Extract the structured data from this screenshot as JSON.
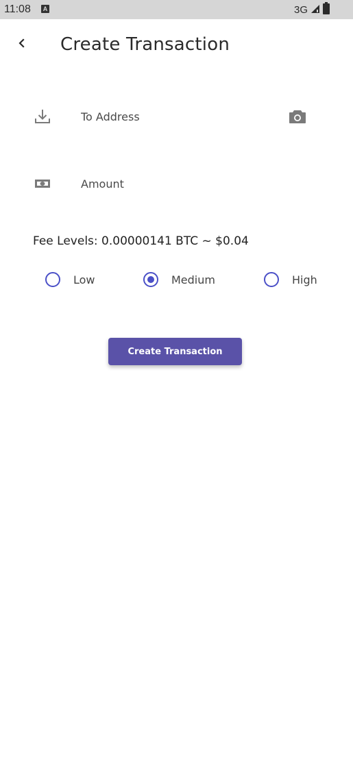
{
  "status_bar": {
    "time": "11:08",
    "notification_icon": "a-icon",
    "network": "3G",
    "signal_icon": "signal-icon",
    "battery_icon": "battery-icon"
  },
  "app_bar": {
    "back_icon": "chevron-left-icon",
    "title": "Create Transaction"
  },
  "form": {
    "to_address": {
      "icon": "download-icon",
      "placeholder": "To Address",
      "value": "",
      "action_icon": "camera-icon"
    },
    "amount": {
      "icon": "cash-icon",
      "placeholder": "Amount",
      "value": ""
    },
    "fee_levels_text": "Fee Levels: 0.00000141 BTC ~ $0.04",
    "fee_options": [
      {
        "label": "Low",
        "selected": false
      },
      {
        "label": "Medium",
        "selected": true
      },
      {
        "label": "High",
        "selected": false
      }
    ],
    "submit_label": "Create Transaction"
  },
  "colors": {
    "accent": "#5a52a8",
    "radio": "#4a4fc7",
    "status_bar": "#d6d6d6",
    "icon_gray": "#7a7a7a"
  }
}
